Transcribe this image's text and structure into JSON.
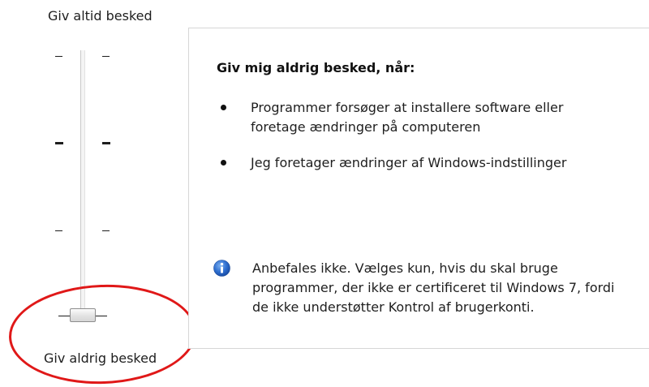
{
  "slider": {
    "top_label": "Giv altid besked",
    "bottom_label": "Giv aldrig besked",
    "level_count": 4,
    "selected_level": 1
  },
  "panel": {
    "heading": "Giv mig aldrig besked, når:",
    "bullets": [
      {
        "text": "Programmer forsøger at installere software eller foretage ændringer på computeren"
      },
      {
        "text": "Jeg foretager ændringer af Windows-indstillinger"
      }
    ],
    "info": {
      "icon": "info-icon",
      "text": "Anbefales ikke. Vælges kun, hvis du skal bruge programmer, der ikke er certificeret til Windows 7, fordi de ikke understøtter Kontrol af brugerkonti."
    }
  },
  "colors": {
    "annotation": "#e01818",
    "info_blue": "#1f5fbf"
  }
}
